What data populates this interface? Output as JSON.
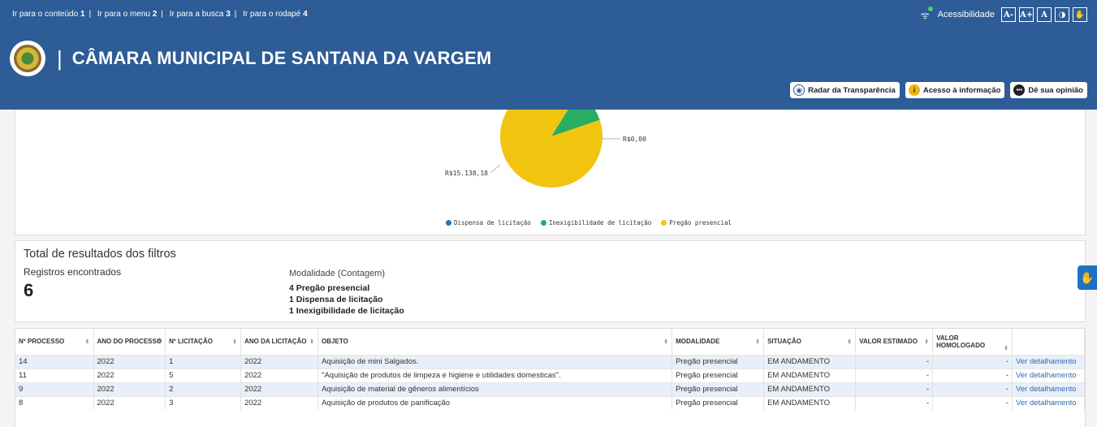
{
  "skiplinks": [
    {
      "label": "Ir para o conteúdo",
      "key": "1"
    },
    {
      "label": "Ir para o menu",
      "key": "2"
    },
    {
      "label": "Ir para a busca",
      "key": "3"
    },
    {
      "label": "Ir para o rodapé",
      "key": "4"
    }
  ],
  "accessibility": {
    "label": "Acessibilidade",
    "buttons": [
      "A-",
      "A+",
      "A",
      "◑",
      "✋"
    ]
  },
  "brand": {
    "separator": "|",
    "title": "CÂMARA MUNICIPAL DE SANTANA DA VARGEM"
  },
  "header_buttons": [
    {
      "label": "Radar da Transparência",
      "icon": "radar-icon",
      "color": "#2d5c96"
    },
    {
      "label": "Acesso à informação",
      "icon": "info-icon",
      "color": "#f2b705"
    },
    {
      "label": "Dê sua opinião",
      "icon": "speech-bubble-icon",
      "color": "#222222"
    }
  ],
  "chart_data": {
    "type": "pie",
    "slices": [
      {
        "label": "Dispensa de licitação",
        "value": 0.0,
        "color": "#1f77b4"
      },
      {
        "label": "Inexigibilidade de licitação",
        "value": 1853.5,
        "color": "#27ae60"
      },
      {
        "label": "Pregão presencial",
        "value": 15138.18,
        "color": "#f1c40f"
      }
    ],
    "data_labels": [
      "R$0,00",
      "R$15.138,18"
    ],
    "legend_position": "bottom"
  },
  "totals": {
    "title": "Total de resultados dos filtros",
    "records_label": "Registros encontrados",
    "records_count": "6",
    "modalidade_label": "Modalidade (Contagem)",
    "modalidade_items": [
      "4 Pregão presencial",
      "1 Dispensa de licitação",
      "1 Inexigibilidade de licitação"
    ]
  },
  "table": {
    "headers": [
      "Nº PROCESSO",
      "ANO DO PROCESSO",
      "Nº LICITAÇÃO",
      "ANO DA LICITAÇÃO",
      "OBJETO",
      "MODALIDADE",
      "SITUAÇÃO",
      "VALOR ESTIMADO",
      "VALOR HOMOLOGADO",
      ""
    ],
    "rows": [
      [
        "14",
        "2022",
        "1",
        "2022",
        "Aquisição de mini Salgados.",
        "Pregão presencial",
        "EM ANDAMENTO",
        "-",
        "-",
        "Ver detalhamento"
      ],
      [
        "11",
        "2022",
        "5",
        "2022",
        "\"Aquisição de produtos de limpeza e higiene e utilidades domesticas\".",
        "Pregão presencial",
        "EM ANDAMENTO",
        "-",
        "-",
        "Ver detalhamento"
      ],
      [
        "9",
        "2022",
        "2",
        "2022",
        "Aquisição de material de gêneros alimentícios",
        "Pregão presencial",
        "EM ANDAMENTO",
        "-",
        "-",
        "Ver detalhamento"
      ],
      [
        "8",
        "2022",
        "3",
        "2022",
        "Aquisição de produtos de panificação",
        "Pregão presencial",
        "EM ANDAMENTO",
        "-",
        "-",
        "Ver detalhamento"
      ]
    ]
  }
}
